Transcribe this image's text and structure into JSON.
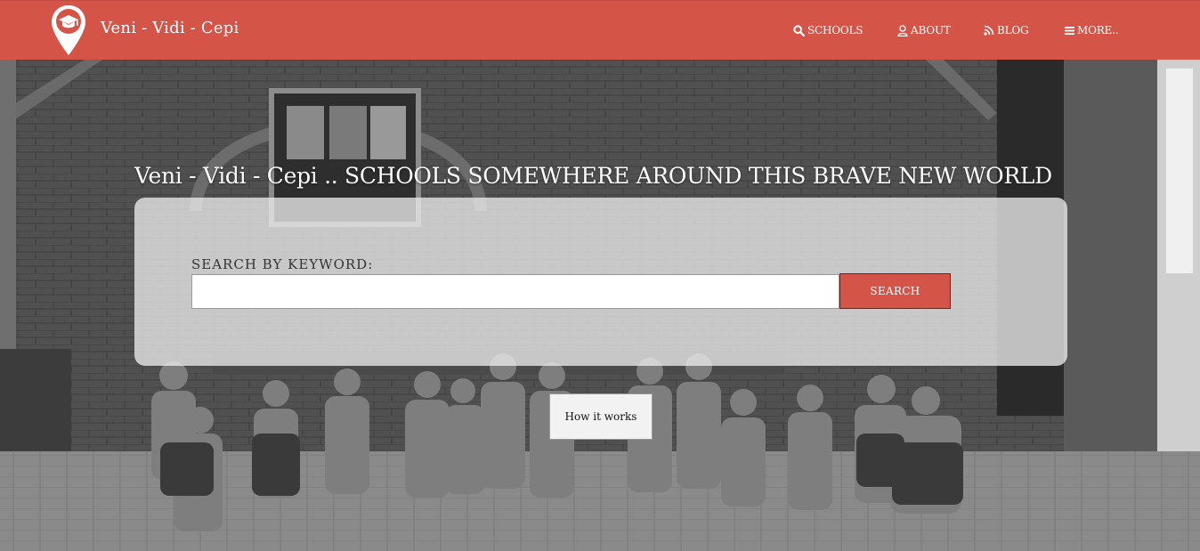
{
  "brand": {
    "name": "Veni - Vidi - Cepi",
    "logo_icon": "map-pin-graduation-cap-icon"
  },
  "nav": {
    "items": [
      {
        "label": "SCHOOLS",
        "icon": "search-icon"
      },
      {
        "label": "ABOUT",
        "icon": "user-icon"
      },
      {
        "label": "BLOG",
        "icon": "rss-icon"
      },
      {
        "label": "MORE..",
        "icon": "bars-icon"
      }
    ]
  },
  "hero": {
    "headline": "Veni - Vidi - Cepi .. SCHOOLS SOMEWHERE AROUND THIS BRAVE NEW WORLD",
    "search": {
      "label": "SEARCH BY KEYWORD:",
      "value": "",
      "placeholder": "",
      "button_label": "SEARCH"
    },
    "how_it_works_label": "How it works"
  },
  "colors": {
    "accent": "#d55448",
    "panel": "#ebebeb",
    "text_light": "#ffffff"
  }
}
